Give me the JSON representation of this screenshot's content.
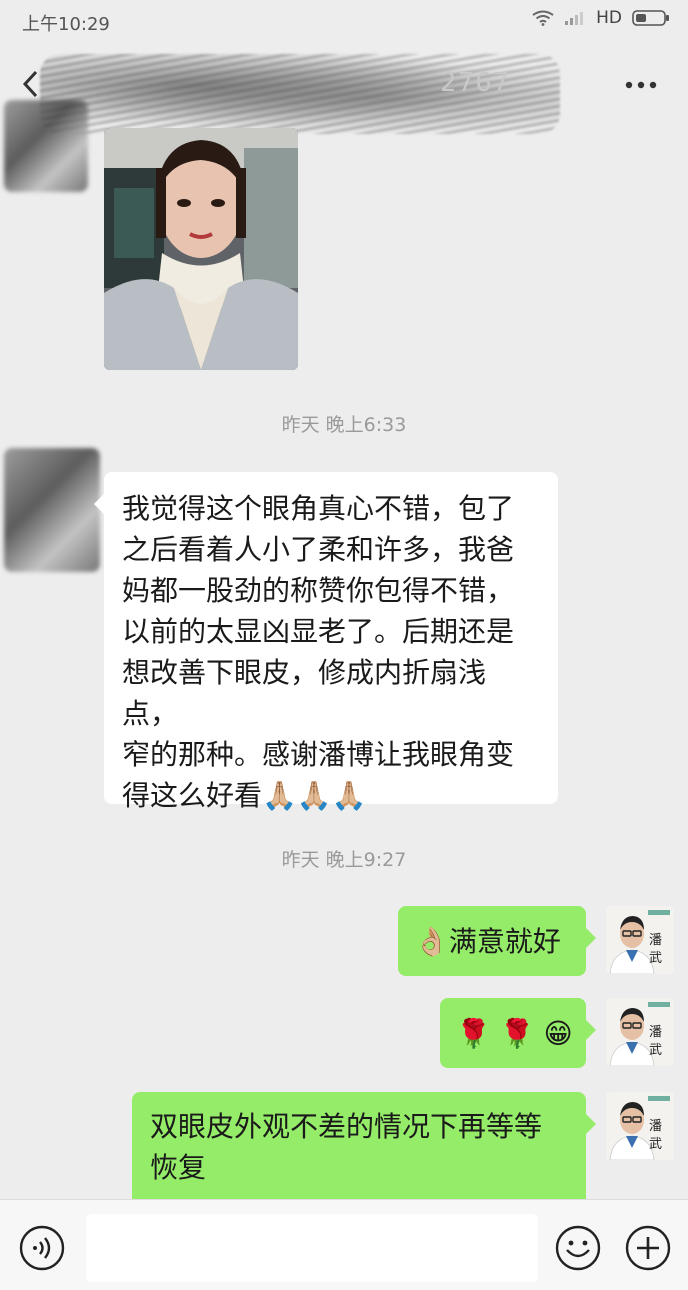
{
  "status_bar": {
    "time": "上午10:29",
    "network": "HD"
  },
  "header": {
    "title_visible_fragment": "2767"
  },
  "messages": [
    {
      "type": "image",
      "side": "left"
    },
    {
      "type": "timestamp",
      "text": "昨天 晚上6:33"
    },
    {
      "type": "text",
      "side": "left",
      "lines": [
        "我觉得这个眼角真心不错，包了",
        "之后看着人小了柔和许多，我爸",
        "妈都一股劲的称赞你包得不错，",
        "以前的太显凶显老了。后期还是",
        "想改善下眼皮，修成内折扇浅点，",
        "窄的那种。感谢潘博让我眼角变",
        "得这么好看🙏🏼🙏🏼🙏🏼"
      ]
    },
    {
      "type": "timestamp",
      "text": "昨天 晚上9:27"
    },
    {
      "type": "text",
      "side": "right",
      "text": "👌🏼满意就好"
    },
    {
      "type": "text",
      "side": "right",
      "text": "🌹 🌹 😁"
    },
    {
      "type": "text",
      "side": "right",
      "lines": [
        "双眼皮外观不差的情况下再等等",
        "恢复"
      ]
    }
  ],
  "doctor_avatar": {
    "name_glyphs": "潘武"
  },
  "composer": {
    "input_value": ""
  }
}
